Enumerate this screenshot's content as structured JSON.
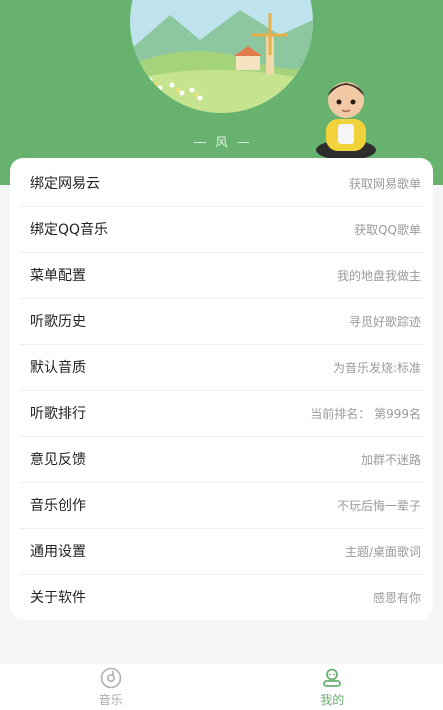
{
  "header": {
    "name": "风"
  },
  "menu": [
    {
      "label": "绑定网易云",
      "desc": "获取网易歌单"
    },
    {
      "label": "绑定QQ音乐",
      "desc": "获取QQ歌单"
    },
    {
      "label": "菜单配置",
      "desc": "我的地盘我做主"
    },
    {
      "label": "听歌历史",
      "desc": "寻觅好歌踪迹"
    },
    {
      "label": "默认音质",
      "desc": "为音乐发烧:标准"
    },
    {
      "label": "听歌排行",
      "desc": "当前排名： 第999名"
    },
    {
      "label": "意见反馈",
      "desc": "加群不迷路"
    },
    {
      "label": "音乐创作",
      "desc": "不玩后悔一辈子"
    },
    {
      "label": "通用设置",
      "desc": "主题/桌面歌词"
    },
    {
      "label": "关于软件",
      "desc": "感恩有你"
    }
  ],
  "tabbar": {
    "tabs": [
      {
        "label": "音乐",
        "icon": "music-disc-icon",
        "active": false
      },
      {
        "label": "我的",
        "icon": "profile-icon",
        "active": true
      }
    ]
  },
  "colors": {
    "primary": "#67b26f",
    "inactive": "#aaaaaa"
  }
}
